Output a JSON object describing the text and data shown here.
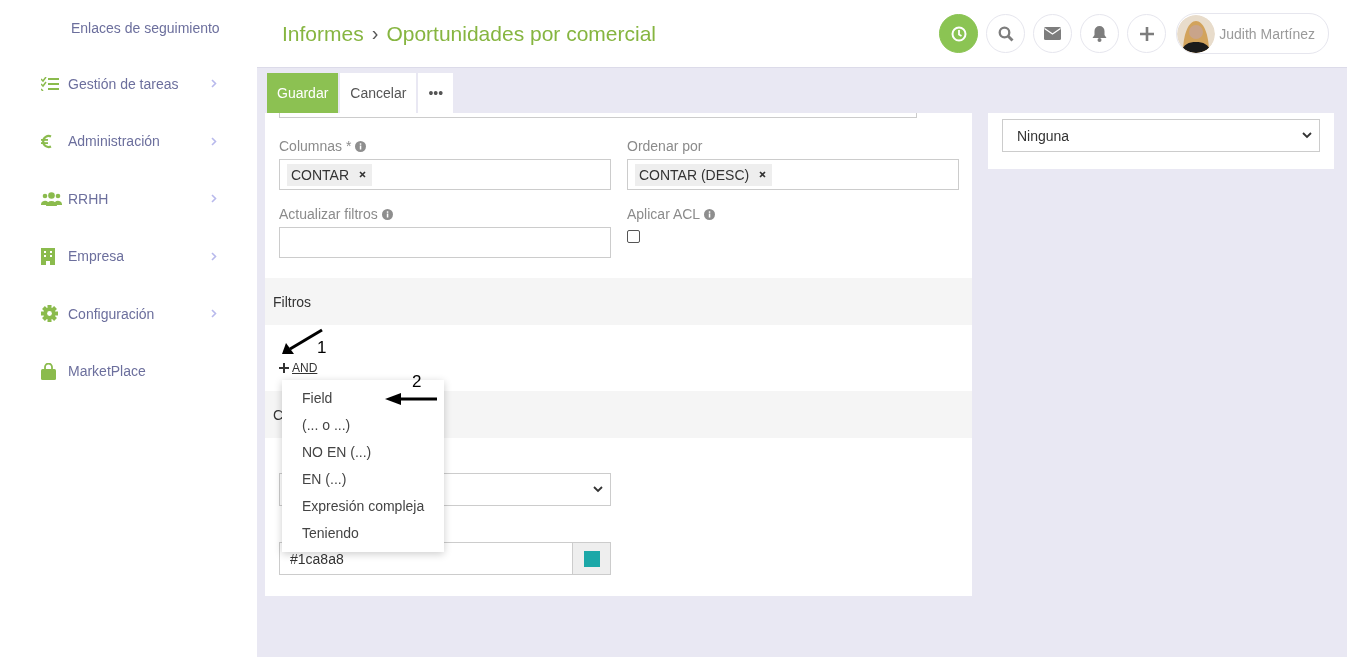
{
  "sidebar": {
    "header": "Enlaces de seguimiento",
    "items": [
      {
        "label": "Gestión de tareas",
        "has_submenu": true
      },
      {
        "label": "Administración",
        "has_submenu": true
      },
      {
        "label": "RRHH",
        "has_submenu": true
      },
      {
        "label": "Empresa",
        "has_submenu": true
      },
      {
        "label": "Configuración",
        "has_submenu": true
      },
      {
        "label": "MarketPlace",
        "has_submenu": false
      }
    ]
  },
  "header": {
    "breadcrumb": [
      "Informes",
      "Oportunidades por comercial"
    ],
    "separator": "›",
    "actions": [
      {
        "kind": "clock",
        "highlighted": true
      },
      {
        "kind": "search",
        "highlighted": false
      },
      {
        "kind": "mail",
        "highlighted": false
      },
      {
        "kind": "bell",
        "highlighted": false
      },
      {
        "kind": "plus",
        "highlighted": false
      }
    ],
    "user": {
      "name": "Judith Martínez"
    }
  },
  "toolbar": {
    "buttons": [
      {
        "label": "Guardar",
        "primary": true
      },
      {
        "label": "Cancelar",
        "primary": false
      },
      {
        "label": "•••",
        "primary": false
      }
    ]
  },
  "form": {
    "fields": [
      {
        "kind": "tags",
        "label": "Columnas *",
        "info": true,
        "tags": [
          "CONTAR"
        ]
      },
      {
        "kind": "tags",
        "label": "Ordenar por",
        "info": false,
        "tags": [
          "CONTAR (DESC)"
        ]
      },
      {
        "kind": "text",
        "label": "Actualizar filtros",
        "info": true
      },
      {
        "kind": "checkbox",
        "label": "Aplicar ACL",
        "info": true,
        "checked": false
      }
    ],
    "filters": {
      "title": "Filtros",
      "add_link": "AND",
      "menu": [
        "Field",
        "(... o ...)",
        "NO EN (...)",
        "EN (...)",
        "Expresión compleja",
        "Teniendo"
      ]
    },
    "section": {
      "title": "C",
      "color_value": "#1ca8a8"
    }
  },
  "right_panel": {
    "select_value": "Ninguna"
  },
  "annotations": [
    {
      "label": "1"
    },
    {
      "label": "2"
    }
  ]
}
